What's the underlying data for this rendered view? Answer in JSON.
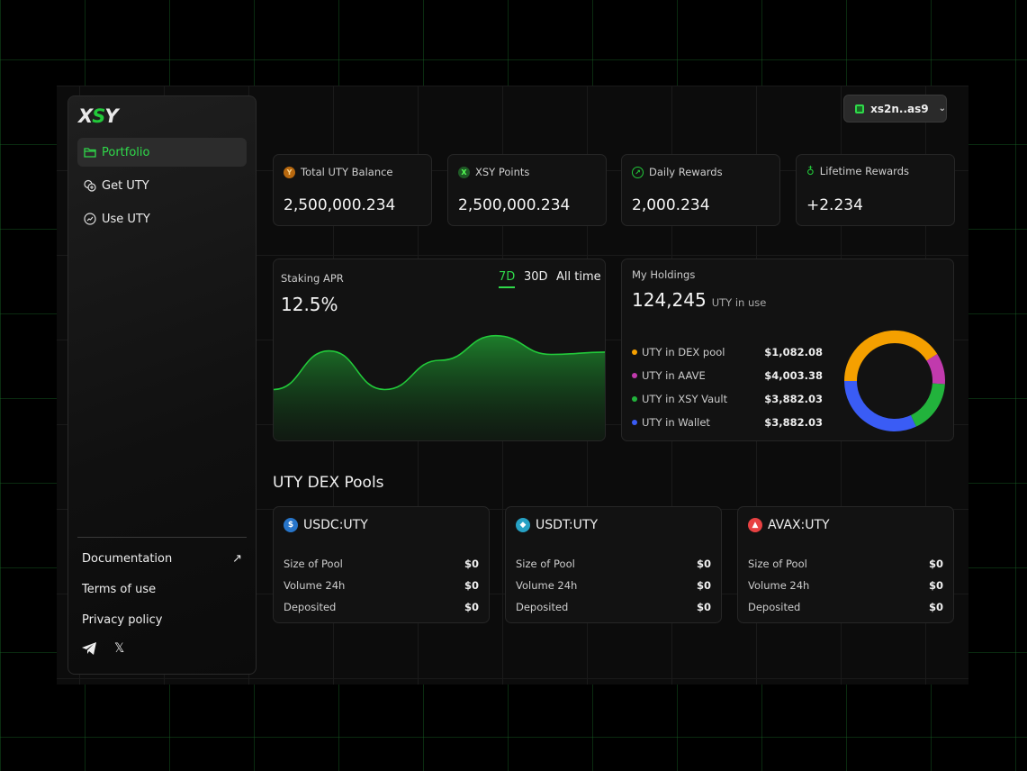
{
  "brand": {
    "logo": "XSY"
  },
  "sidebar": {
    "items": [
      {
        "label": "Portfolio",
        "icon": "folder-icon",
        "active": true
      },
      {
        "label": "Get UTY",
        "icon": "coins-plus-icon"
      },
      {
        "label": "Use UTY",
        "icon": "trend-circle-icon"
      }
    ],
    "footer": {
      "documentation": "Documentation",
      "terms": "Terms of use",
      "privacy": "Privacy policy"
    }
  },
  "wallet": {
    "address": "xs2n..as9"
  },
  "stats": [
    {
      "label": "Total UTY Balance",
      "value": "2,500,000.234",
      "icon": "uty-coin-icon",
      "color": "#b8680e"
    },
    {
      "label": "XSY Points",
      "value": "2,500,000.234",
      "icon": "xsy-icon",
      "color": "#1f5a26"
    },
    {
      "label": "Daily Rewards",
      "value": "2,000.234",
      "icon": "chart-circle-icon",
      "color": "#22c93a"
    },
    {
      "label": "Lifetime Rewards",
      "value": "+2.234",
      "icon": "money-bag-icon",
      "color": "#22c93a"
    }
  ],
  "apr": {
    "title": "Staking APR",
    "value": "12.5%",
    "tabs": [
      "7D",
      "30D",
      "All time"
    ],
    "active_tab": "7D"
  },
  "chart_data": {
    "type": "area",
    "title": "Staking APR",
    "x": [
      1,
      2,
      3,
      4,
      5,
      6,
      7
    ],
    "values": [
      45,
      78,
      45,
      70,
      91,
      75,
      77
    ],
    "ylim": [
      0,
      100
    ],
    "color": "#22c93a",
    "grid": false
  },
  "holdings": {
    "title": "My Holdings",
    "total": "124,245",
    "unit": "UTY in use",
    "items": [
      {
        "label": "UTY in DEX pool",
        "amount": "$1,082.08",
        "color": "#f5a000",
        "share": 0.41
      },
      {
        "label": "UTY in AAVE",
        "amount": "$4,003.38",
        "color": "#c13aad",
        "share": 0.1
      },
      {
        "label": "UTY in XSY Vault",
        "amount": "$3,882.03",
        "color": "#22b33c",
        "share": 0.17
      },
      {
        "label": "UTY in Wallet",
        "amount": "$3,882.03",
        "color": "#3a5cf5",
        "share": 0.32
      }
    ]
  },
  "pools": {
    "title": "UTY DEX Pools",
    "row_labels": [
      "Size of Pool",
      "Volume 24h",
      "Deposited"
    ],
    "items": [
      {
        "name": "USDC:UTY",
        "icon": "usdc-icon",
        "color": "#2775ca",
        "values": [
          "$0",
          "$0",
          "$0"
        ]
      },
      {
        "name": "USDT:UTY",
        "icon": "usdt-icon",
        "color": "#26a1c4",
        "values": [
          "$0",
          "$0",
          "$0"
        ]
      },
      {
        "name": "AVAX:UTY",
        "icon": "avax-icon",
        "color": "#e84142",
        "values": [
          "$0",
          "$0",
          "$0"
        ]
      }
    ]
  }
}
